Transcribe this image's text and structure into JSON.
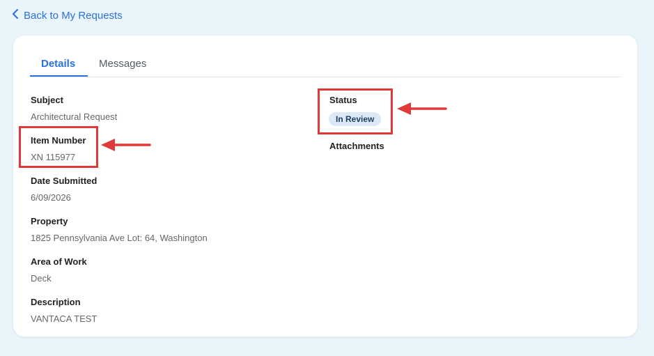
{
  "nav": {
    "back_label": "Back to My Requests"
  },
  "tabs": [
    {
      "label": "Details",
      "active": true
    },
    {
      "label": "Messages",
      "active": false
    }
  ],
  "left_fields": [
    {
      "label": "Subject",
      "value": "Architectural Request"
    },
    {
      "label": "Item Number",
      "value": "XN 115977"
    },
    {
      "label": "Date Submitted",
      "value": "6/09/2026"
    },
    {
      "label": "Property",
      "value": "1825 Pennsylvania Ave Lot: 64, Washington"
    },
    {
      "label": "Area of Work",
      "value": "Deck"
    },
    {
      "label": "Description",
      "value": "VANTACA TEST"
    }
  ],
  "status": {
    "label": "Status",
    "value": "In Review"
  },
  "attachments": {
    "label": "Attachments"
  },
  "colors": {
    "accent": "#2a6fe0",
    "highlight": "#e0393a",
    "badge_bg": "#dbe9f7"
  }
}
